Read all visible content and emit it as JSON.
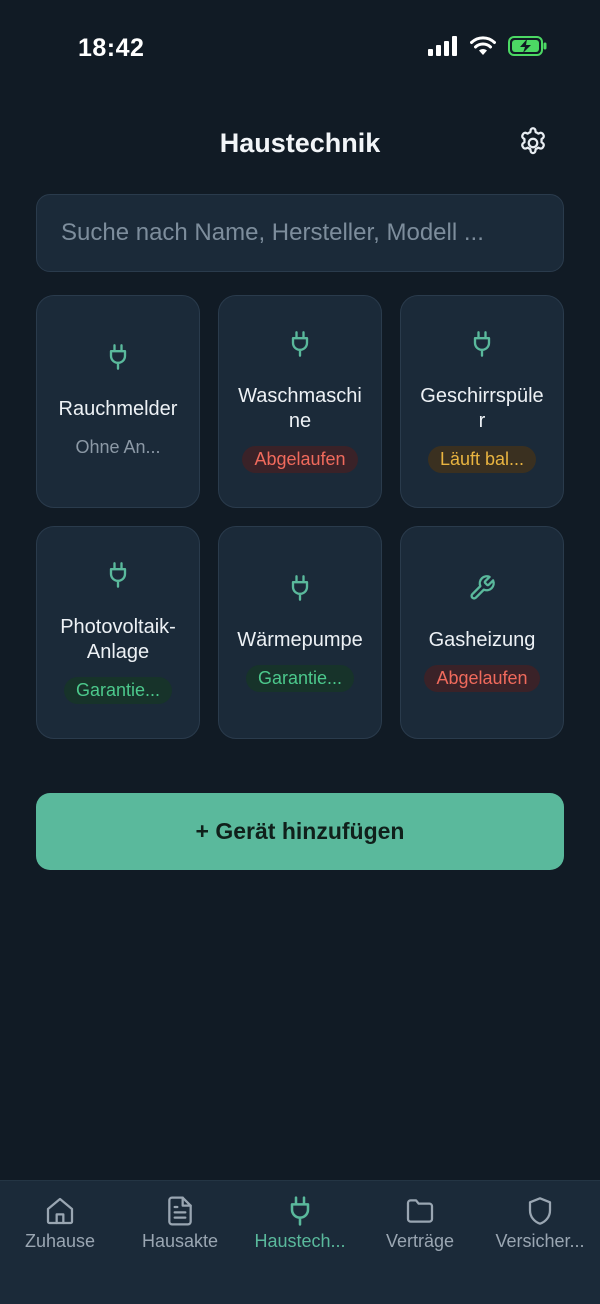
{
  "status_bar": {
    "time": "18:42"
  },
  "header": {
    "title": "Haustechnik",
    "settings_icon": "gear-icon"
  },
  "search": {
    "placeholder": "Suche nach Name, Hersteller, Modell ..."
  },
  "devices": [
    {
      "name": "Rauchmelder",
      "icon": "plug-icon",
      "status": "Ohne An...",
      "status_type": "none"
    },
    {
      "name": "Waschmaschine",
      "icon": "plug-icon",
      "status": "Abgelaufen",
      "status_type": "expired"
    },
    {
      "name": "Geschirrspüler",
      "icon": "plug-icon",
      "status": "Läuft bal...",
      "status_type": "soon"
    },
    {
      "name": "Photovoltaik-Anlage",
      "icon": "plug-icon",
      "status": "Garantie...",
      "status_type": "guarantee"
    },
    {
      "name": "Wärmepumpe",
      "icon": "plug-icon",
      "status": "Garantie...",
      "status_type": "guarantee"
    },
    {
      "name": "Gasheizung",
      "icon": "wrench-icon",
      "status": "Abgelaufen",
      "status_type": "expired"
    }
  ],
  "add_button": {
    "label": "+ Gerät hinzufügen"
  },
  "tabbar": {
    "items": [
      {
        "label": "Zuhause",
        "icon": "home-icon",
        "active": false
      },
      {
        "label": "Hausakte",
        "icon": "document-icon",
        "active": false
      },
      {
        "label": "Haustech...",
        "icon": "plug-icon",
        "active": true
      },
      {
        "label": "Verträge",
        "icon": "folder-icon",
        "active": false
      },
      {
        "label": "Versicher...",
        "icon": "shield-icon",
        "active": false
      }
    ]
  },
  "colors": {
    "background": "#111b25",
    "card": "#1b2a39",
    "accent": "#5ab99c",
    "expired": "#f06a5c",
    "soon": "#e9b440",
    "guarantee": "#4cc88c"
  }
}
